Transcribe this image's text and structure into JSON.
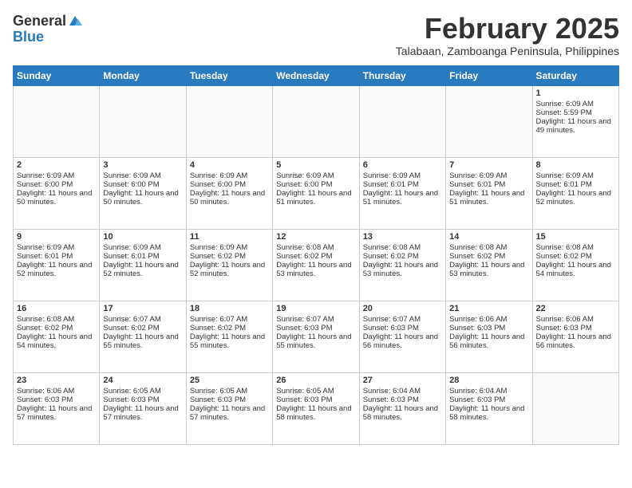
{
  "header": {
    "logo_general": "General",
    "logo_blue": "Blue",
    "month": "February 2025",
    "location": "Talabaan, Zamboanga Peninsula, Philippines"
  },
  "weekdays": [
    "Sunday",
    "Monday",
    "Tuesday",
    "Wednesday",
    "Thursday",
    "Friday",
    "Saturday"
  ],
  "weeks": [
    [
      {
        "day": "",
        "info": ""
      },
      {
        "day": "",
        "info": ""
      },
      {
        "day": "",
        "info": ""
      },
      {
        "day": "",
        "info": ""
      },
      {
        "day": "",
        "info": ""
      },
      {
        "day": "",
        "info": ""
      },
      {
        "day": "1",
        "info": "Sunrise: 6:09 AM\nSunset: 5:59 PM\nDaylight: 11 hours and 49 minutes."
      }
    ],
    [
      {
        "day": "2",
        "info": "Sunrise: 6:09 AM\nSunset: 6:00 PM\nDaylight: 11 hours and 50 minutes."
      },
      {
        "day": "3",
        "info": "Sunrise: 6:09 AM\nSunset: 6:00 PM\nDaylight: 11 hours and 50 minutes."
      },
      {
        "day": "4",
        "info": "Sunrise: 6:09 AM\nSunset: 6:00 PM\nDaylight: 11 hours and 50 minutes."
      },
      {
        "day": "5",
        "info": "Sunrise: 6:09 AM\nSunset: 6:00 PM\nDaylight: 11 hours and 51 minutes."
      },
      {
        "day": "6",
        "info": "Sunrise: 6:09 AM\nSunset: 6:01 PM\nDaylight: 11 hours and 51 minutes."
      },
      {
        "day": "7",
        "info": "Sunrise: 6:09 AM\nSunset: 6:01 PM\nDaylight: 11 hours and 51 minutes."
      },
      {
        "day": "8",
        "info": "Sunrise: 6:09 AM\nSunset: 6:01 PM\nDaylight: 11 hours and 52 minutes."
      }
    ],
    [
      {
        "day": "9",
        "info": "Sunrise: 6:09 AM\nSunset: 6:01 PM\nDaylight: 11 hours and 52 minutes."
      },
      {
        "day": "10",
        "info": "Sunrise: 6:09 AM\nSunset: 6:01 PM\nDaylight: 11 hours and 52 minutes."
      },
      {
        "day": "11",
        "info": "Sunrise: 6:09 AM\nSunset: 6:02 PM\nDaylight: 11 hours and 52 minutes."
      },
      {
        "day": "12",
        "info": "Sunrise: 6:08 AM\nSunset: 6:02 PM\nDaylight: 11 hours and 53 minutes."
      },
      {
        "day": "13",
        "info": "Sunrise: 6:08 AM\nSunset: 6:02 PM\nDaylight: 11 hours and 53 minutes."
      },
      {
        "day": "14",
        "info": "Sunrise: 6:08 AM\nSunset: 6:02 PM\nDaylight: 11 hours and 53 minutes."
      },
      {
        "day": "15",
        "info": "Sunrise: 6:08 AM\nSunset: 6:02 PM\nDaylight: 11 hours and 54 minutes."
      }
    ],
    [
      {
        "day": "16",
        "info": "Sunrise: 6:08 AM\nSunset: 6:02 PM\nDaylight: 11 hours and 54 minutes."
      },
      {
        "day": "17",
        "info": "Sunrise: 6:07 AM\nSunset: 6:02 PM\nDaylight: 11 hours and 55 minutes."
      },
      {
        "day": "18",
        "info": "Sunrise: 6:07 AM\nSunset: 6:02 PM\nDaylight: 11 hours and 55 minutes."
      },
      {
        "day": "19",
        "info": "Sunrise: 6:07 AM\nSunset: 6:03 PM\nDaylight: 11 hours and 55 minutes."
      },
      {
        "day": "20",
        "info": "Sunrise: 6:07 AM\nSunset: 6:03 PM\nDaylight: 11 hours and 56 minutes."
      },
      {
        "day": "21",
        "info": "Sunrise: 6:06 AM\nSunset: 6:03 PM\nDaylight: 11 hours and 56 minutes."
      },
      {
        "day": "22",
        "info": "Sunrise: 6:06 AM\nSunset: 6:03 PM\nDaylight: 11 hours and 56 minutes."
      }
    ],
    [
      {
        "day": "23",
        "info": "Sunrise: 6:06 AM\nSunset: 6:03 PM\nDaylight: 11 hours and 57 minutes."
      },
      {
        "day": "24",
        "info": "Sunrise: 6:05 AM\nSunset: 6:03 PM\nDaylight: 11 hours and 57 minutes."
      },
      {
        "day": "25",
        "info": "Sunrise: 6:05 AM\nSunset: 6:03 PM\nDaylight: 11 hours and 57 minutes."
      },
      {
        "day": "26",
        "info": "Sunrise: 6:05 AM\nSunset: 6:03 PM\nDaylight: 11 hours and 58 minutes."
      },
      {
        "day": "27",
        "info": "Sunrise: 6:04 AM\nSunset: 6:03 PM\nDaylight: 11 hours and 58 minutes."
      },
      {
        "day": "28",
        "info": "Sunrise: 6:04 AM\nSunset: 6:03 PM\nDaylight: 11 hours and 58 minutes."
      },
      {
        "day": "",
        "info": ""
      }
    ]
  ]
}
